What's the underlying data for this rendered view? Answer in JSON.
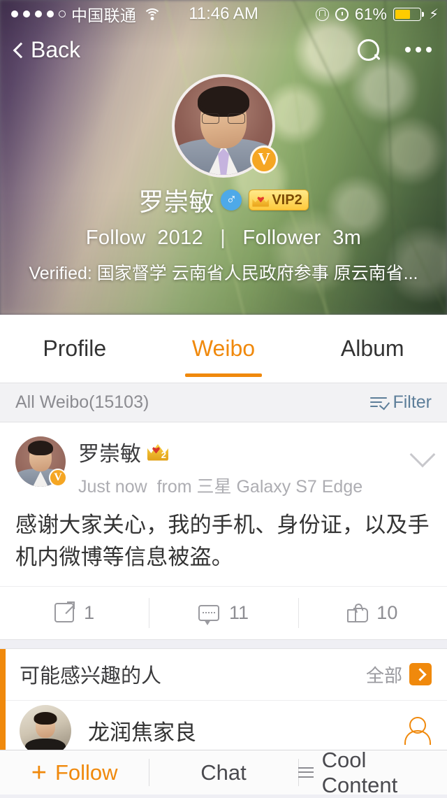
{
  "status_bar": {
    "signal_dots": 5,
    "signal_filled": 4,
    "carrier": "中国联通",
    "wifi_icon": "wifi-icon",
    "time": "11:46 AM",
    "rotation_lock_icon": "rotation-lock-icon",
    "alarm_icon": "alarm-clock-icon",
    "battery_percent": "61%",
    "battery_level": 61,
    "charging_icon": "lightning-bolt-icon"
  },
  "nav": {
    "back_label": "Back",
    "back_icon": "chevron-left-icon",
    "search_icon": "search-icon",
    "more_icon": "more-horizontal-icon"
  },
  "profile": {
    "avatar_icon": "user-avatar",
    "verified_badge": "V",
    "name": "罗崇敏",
    "gender_icon": "male-gender-icon",
    "gender_symbol": "♂",
    "vip_label": "VIP2",
    "vip_crown_icon": "crown-icon",
    "follow_label": "Follow",
    "follow_count": "2012",
    "separator": "|",
    "follower_label": "Follower",
    "follower_count": "3m",
    "verified_text": "Verified: 国家督学 云南省人民政府参事 原云南省..."
  },
  "tabs": [
    {
      "label": "Profile",
      "active": false
    },
    {
      "label": "Weibo",
      "active": true
    },
    {
      "label": "Album",
      "active": false
    }
  ],
  "filter_bar": {
    "all_label": "All Weibo(15103)",
    "filter_label": "Filter",
    "filter_icon": "filter-icon"
  },
  "post": {
    "avatar_icon": "user-avatar",
    "verified_badge": "V",
    "author": "罗崇敏",
    "crown_icon": "crown-icon",
    "crown_level": "2",
    "time": "Just now",
    "source": "from 三星 Galaxy S7 Edge",
    "expand_icon": "chevron-down-icon",
    "body": "感谢大家关心，我的手机、身份证，以及手机内微博等信息被盗。",
    "actions": [
      {
        "name": "share",
        "icon": "share-icon",
        "count": "1"
      },
      {
        "name": "comment",
        "icon": "comment-icon",
        "count": "11"
      },
      {
        "name": "like",
        "icon": "thumbs-up-icon",
        "count": "10"
      }
    ]
  },
  "recommend": {
    "title": "可能感兴趣的人",
    "all_label": "全部",
    "arrow_icon": "chevron-right-icon",
    "people": [
      {
        "name": "龙润焦家良",
        "avatar_icon": "user-avatar",
        "add_icon": "add-person-icon"
      }
    ]
  },
  "bottom_bar": [
    {
      "label": "Follow",
      "icon": "plus-icon",
      "accent": true
    },
    {
      "label": "Chat",
      "icon": null,
      "accent": false
    },
    {
      "label": "Cool Content",
      "icon": "hamburger-icon",
      "accent": false
    }
  ],
  "colors": {
    "accent": "#f0890c",
    "filter_blue": "#5d7e99",
    "battery_yellow": "#ffcc00",
    "gender_blue": "#4ea9e8"
  }
}
